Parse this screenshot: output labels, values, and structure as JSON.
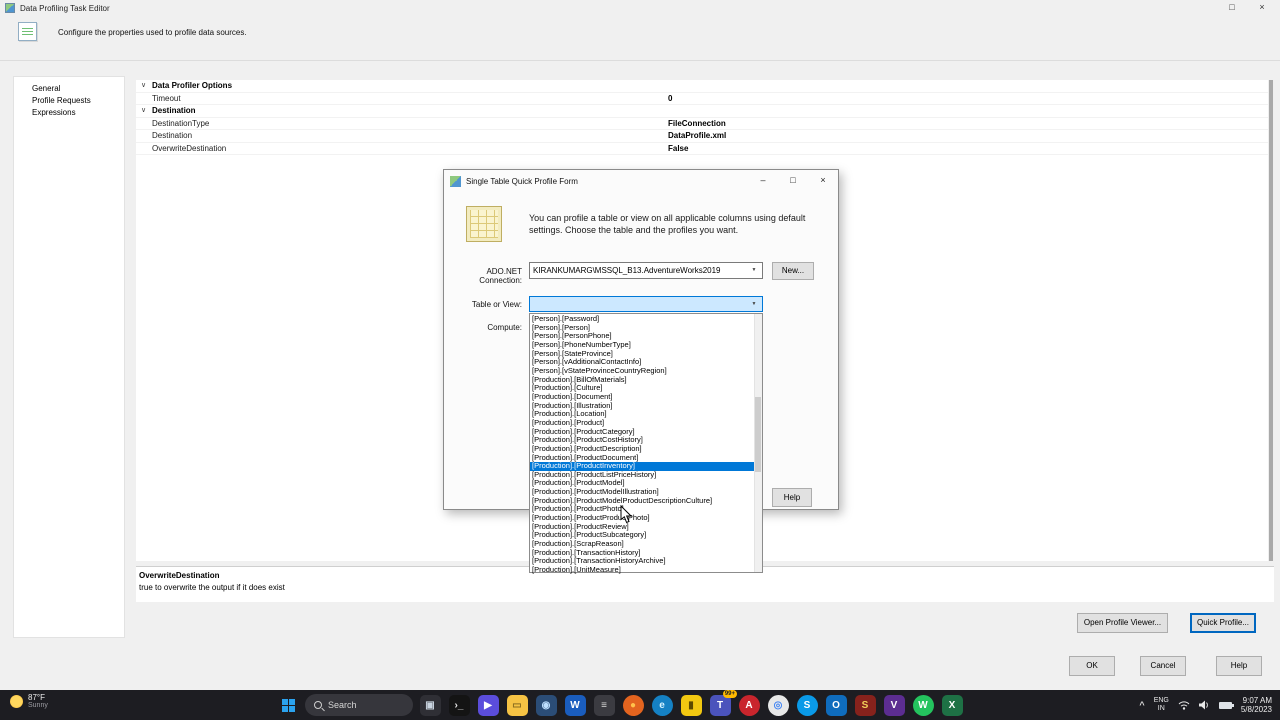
{
  "window": {
    "title": "Data Profiling Task Editor",
    "description": "Configure the properties used to profile data sources."
  },
  "sidebar": {
    "items": [
      "General",
      "Profile Requests",
      "Expressions"
    ]
  },
  "property_grid": {
    "groups": [
      {
        "label": "Data Profiler Options",
        "rows": [
          {
            "name": "Timeout",
            "value": "0"
          }
        ]
      },
      {
        "label": "Destination",
        "rows": [
          {
            "name": "DestinationType",
            "value": "FileConnection"
          },
          {
            "name": "Destination",
            "value": "DataProfile.xml"
          },
          {
            "name": "OverwriteDestination",
            "value": "False"
          }
        ]
      }
    ]
  },
  "description_panel": {
    "title": "OverwriteDestination",
    "text": "true to overwrite the output if it does exist"
  },
  "footer_buttons": {
    "open_profile_viewer": "Open Profile Viewer...",
    "quick_profile": "Quick Profile...",
    "ok": "OK",
    "cancel": "Cancel",
    "help": "Help"
  },
  "dialog": {
    "title": "Single Table Quick Profile Form",
    "intro": "You can profile a table or view on all applicable columns using default settings. Choose the table and the profiles you want.",
    "connection_label": "ADO.NET Connection:",
    "connection_value": "KIRANKUMARG\\MSSQL_B13.AdventureWorks2019",
    "new_button": "New...",
    "table_label": "Table or View:",
    "compute_label": "Compute:",
    "help_button": "Help",
    "dropdown": {
      "selected": "[Production].[ProductInventory]",
      "items": [
        "[Person].[Password]",
        "[Person].[Person]",
        "[Person].[PersonPhone]",
        "[Person].[PhoneNumberType]",
        "[Person].[StateProvince]",
        "[Person].[vAdditionalContactInfo]",
        "[Person].[vStateProvinceCountryRegion]",
        "[Production].[BillOfMaterials]",
        "[Production].[Culture]",
        "[Production].[Document]",
        "[Production].[Illustration]",
        "[Production].[Location]",
        "[Production].[Product]",
        "[Production].[ProductCategory]",
        "[Production].[ProductCostHistory]",
        "[Production].[ProductDescription]",
        "[Production].[ProductDocument]",
        "[Production].[ProductInventory]",
        "[Production].[ProductListPriceHistory]",
        "[Production].[ProductModel]",
        "[Production].[ProductModelIllustration]",
        "[Production].[ProductModelProductDescriptionCulture]",
        "[Production].[ProductPhoto]",
        "[Production].[ProductProductPhoto]",
        "[Production].[ProductReview]",
        "[Production].[ProductSubcategory]",
        "[Production].[ScrapReason]",
        "[Production].[TransactionHistory]",
        "[Production].[TransactionHistoryArchive]",
        "[Production].[UnitMeasure]"
      ]
    }
  },
  "taskbar": {
    "weather": {
      "temp": "87°F",
      "condition": "Sunny"
    },
    "search_placeholder": "Search",
    "icons": [
      {
        "name": "task-view-icon",
        "glyph": "▣",
        "bg": "#2f2f35",
        "fg": "#c9d4e0"
      },
      {
        "name": "terminal-icon",
        "glyph": "›_",
        "bg": "#141414",
        "fg": "#e6e6e6"
      },
      {
        "name": "media-player-icon",
        "glyph": "▶",
        "bg": "#5b4ddc",
        "fg": "#ffffff"
      },
      {
        "name": "file-explorer-icon",
        "glyph": "▭",
        "bg": "#f6c344",
        "fg": "#8a6d1f"
      },
      {
        "name": "photos-icon",
        "glyph": "◉",
        "bg": "#2b4d77",
        "fg": "#bfe0ff"
      },
      {
        "name": "word-icon",
        "glyph": "W",
        "bg": "#1a5dbe",
        "fg": "#ffffff"
      },
      {
        "name": "notepad-icon",
        "glyph": "≡",
        "bg": "#3b3b41",
        "fg": "#d8d8d8"
      },
      {
        "name": "firefox-icon",
        "glyph": "●",
        "bg": "#e3641f",
        "fg": "#ffc24b",
        "round": true
      },
      {
        "name": "edge-icon",
        "glyph": "e",
        "bg": "#1581c4",
        "fg": "#d6f3ff",
        "round": true
      },
      {
        "name": "power-bi-icon",
        "glyph": "▮",
        "bg": "#f2c811",
        "fg": "#5c4a00"
      },
      {
        "name": "teams-icon",
        "glyph": "T",
        "bg": "#4b53bc",
        "fg": "#ffffff",
        "badge": "99+"
      },
      {
        "name": "adobe-reader-icon",
        "glyph": "A",
        "bg": "#c9252d",
        "fg": "#ffffff",
        "round": true
      },
      {
        "name": "chrome-icon",
        "glyph": "◎",
        "bg": "#e8e8e8",
        "fg": "#4285f4",
        "round": true
      },
      {
        "name": "skype-icon",
        "glyph": "S",
        "bg": "#0a9ae8",
        "fg": "#ffffff",
        "round": true
      },
      {
        "name": "outlook-icon",
        "glyph": "O",
        "bg": "#0f6cbd",
        "fg": "#ffffff"
      },
      {
        "name": "ssms-icon",
        "glyph": "S",
        "bg": "#87221c",
        "fg": "#f3cf5a"
      },
      {
        "name": "visual-studio-icon",
        "glyph": "V",
        "bg": "#5c2d91",
        "fg": "#ffffff"
      },
      {
        "name": "whatsapp-icon",
        "glyph": "W",
        "bg": "#24c35e",
        "fg": "#ffffff",
        "round": true
      },
      {
        "name": "excel-icon",
        "glyph": "X",
        "bg": "#1e7145",
        "fg": "#ffffff"
      }
    ],
    "tray": {
      "lang_top": "ENG",
      "lang_bottom": "IN",
      "time": "9:07 AM",
      "date": "5/8/2023"
    }
  },
  "colors": {
    "accent": "#0078d7",
    "selection_text": "#ffffff",
    "taskbar": "#1d1d22"
  }
}
